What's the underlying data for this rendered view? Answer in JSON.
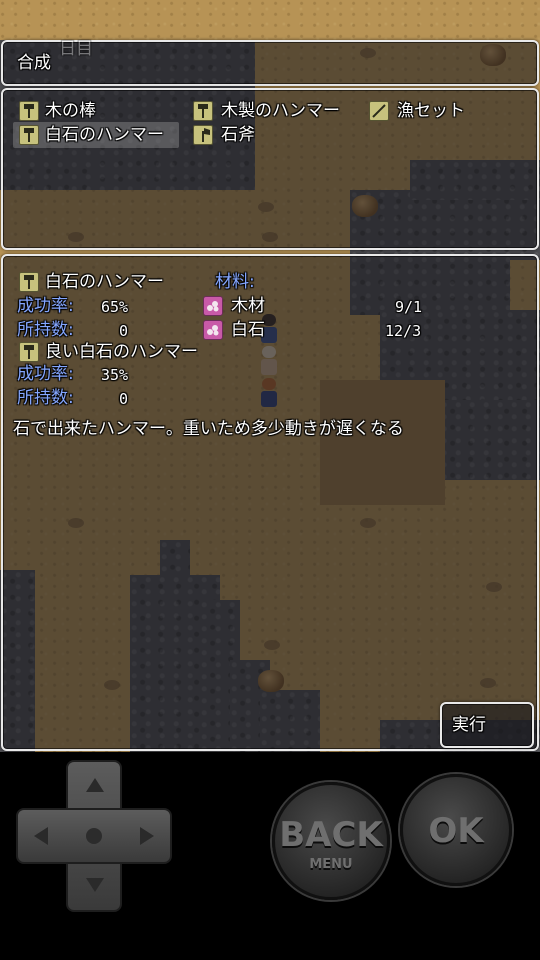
{
  "header": {
    "title": "合成",
    "faded_day_text": "日目"
  },
  "recipes": {
    "items": [
      {
        "label": "木の棒",
        "icon": "hammer-icon",
        "selected": false
      },
      {
        "label": "木製のハンマー",
        "icon": "hammer-icon",
        "selected": false
      },
      {
        "label": "漁セット",
        "icon": "fishing-set-icon",
        "selected": false
      },
      {
        "label": "白石のハンマー",
        "icon": "hammer-icon",
        "selected": true
      },
      {
        "label": "石斧",
        "icon": "axe-icon",
        "selected": false
      }
    ]
  },
  "detail": {
    "item_name": "白石のハンマー",
    "success_label": "成功率:",
    "success_value": "65%",
    "owned_label": "所持数:",
    "owned_value": "0",
    "great_item_name": "良い白石のハンマー",
    "great_success_label": "成功率:",
    "great_success_value": "35%",
    "great_owned_label": "所持数:",
    "great_owned_value": "0",
    "materials_label": "材料:",
    "materials": [
      {
        "name": "木材",
        "count": "9/1",
        "icon": "material-icon"
      },
      {
        "name": "白石",
        "count": "12/3",
        "icon": "material-icon"
      }
    ],
    "description": "石で出来たハンマー。重いため多少動きが遅くなる"
  },
  "execute_label": "実行",
  "controls": {
    "back_label": "BACK",
    "back_sub": "MENU",
    "ok_label": "OK"
  },
  "colors": {
    "system_text": "#84a6ff",
    "window_border": "#e9e9e9",
    "ground": "#b79355",
    "rock": "#4e4e52"
  }
}
